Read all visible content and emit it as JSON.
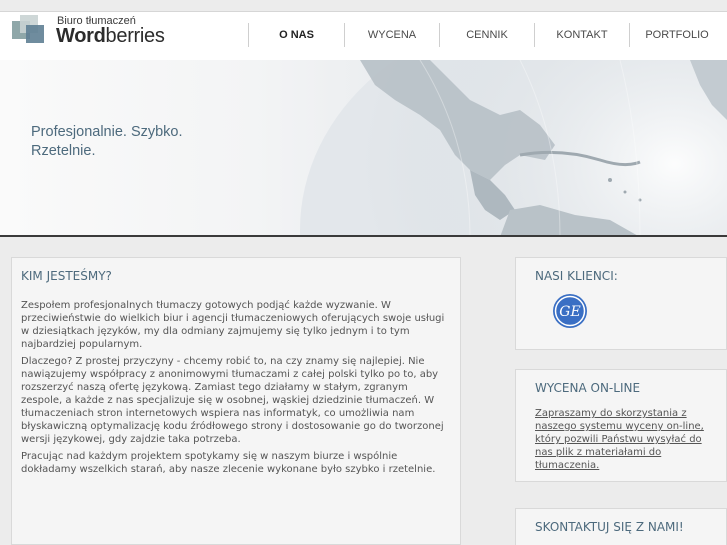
{
  "logo": {
    "tagline": "Biuro tłumaczeń",
    "name_bold": "Word",
    "name_regular": "berries"
  },
  "nav": {
    "items": [
      {
        "label": "O NAS",
        "active": true
      },
      {
        "label": "WYCENA",
        "active": false
      },
      {
        "label": "CENNIK",
        "active": false
      },
      {
        "label": "KONTAKT",
        "active": false
      },
      {
        "label": "PORTFOLIO",
        "active": false
      }
    ]
  },
  "hero": {
    "line1": "Profesjonalnie. Szybko.",
    "line2": "Rzetelnie."
  },
  "about": {
    "title": "KIM JESTEŚMY?",
    "paragraphs": [
      "Zespołem profesjonalnych tłumaczy gotowych podjąć każde wyzwanie. W przeciwieństwie do wielkich biur i agencji tłumaczeniowych oferujących swoje usługi w dziesiątkach języków, my dla odmiany zajmujemy się tylko jednym i to tym najbardziej popularnym.",
      "Dlaczego? Z prostej przyczyny - chcemy robić to, na czy znamy się najlepiej. Nie nawiązujemy współpracy z anonimowymi tłumaczami z całej polski tylko po to, aby rozszerzyć naszą ofertę językową. Zamiast tego działamy w stałym, zgranym zespole, a każde z nas specjalizuje się w osobnej, wąskiej dziedzinie tłumaczeń. W tłumaczeniach stron internetowych wspiera nas informatyk, co umożliwia nam błyskawiczną optymalizację kodu źródłowego strony i dostosowanie go do tworzonej wersji językowej, gdy zajdzie taka potrzeba.",
      "Pracując nad każdym projektem spotykamy się w naszym biurze i wspólnie dokładamy wszelkich starań, aby nasze zlecenie wykonane było szybko i rzetelnie."
    ]
  },
  "clients": {
    "title": "NASI KLIENCI:",
    "logos": [
      "ge-logo-icon"
    ]
  },
  "wycena": {
    "title": "WYCENA ON-LINE",
    "link_text": "Zapraszamy do skorzystania z naszego systemu wyceny on-line, który pozwili Państwu wysyłać do nas plik z materiałami do tłumaczenia."
  },
  "kontakt": {
    "title": "SKONTAKTUJ SIĘ Z NAMI!"
  },
  "colors": {
    "accent": "#4d6a7d",
    "ge_blue": "#3a6fc4"
  }
}
